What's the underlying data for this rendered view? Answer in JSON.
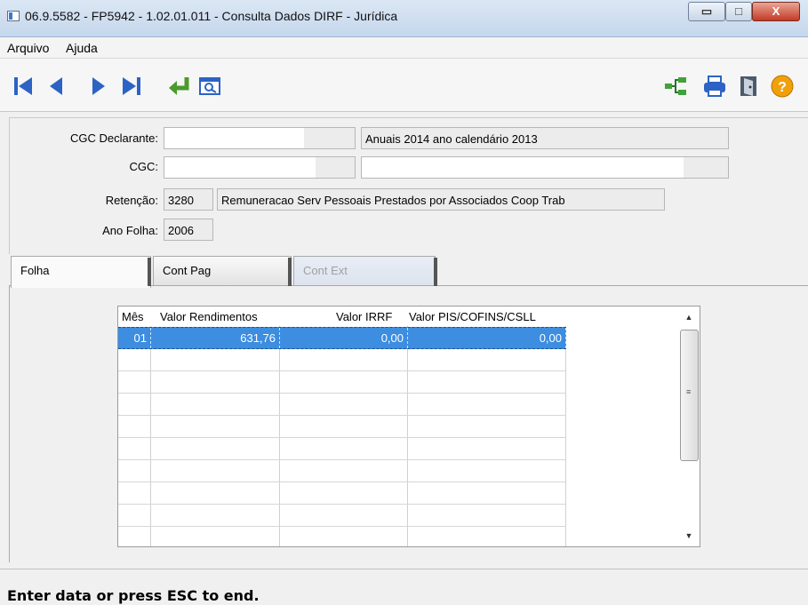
{
  "window": {
    "title": "06.9.5582 - FP5942 - 1.02.01.011 - Consulta Dados DIRF - Jurídica",
    "controls": {
      "minimize": "▭",
      "maximize": "□",
      "close": "X"
    }
  },
  "menu": [
    {
      "label": "Arquivo"
    },
    {
      "label": "Ajuda"
    }
  ],
  "toolbar": {
    "icons": [
      "first-record-icon",
      "previous-record-icon",
      "next-record-icon",
      "last-record-icon",
      "return-icon",
      "search-window-icon",
      "tree-structure-icon",
      "print-icon",
      "exit-door-icon",
      "help-icon"
    ],
    "accent": "#2c63c4"
  },
  "form": {
    "cgc_declarante": {
      "label": "CGC Declarante:",
      "value": "",
      "description": "Anuais 2014 ano calendário 2013"
    },
    "cgc": {
      "label": "CGC:",
      "value": "",
      "description": ""
    },
    "retencao": {
      "label": "Retenção:",
      "code": "3280",
      "description": "Remuneracao Serv Pessoais Prestados por Associados Coop Trab"
    },
    "ano_folha": {
      "label": "Ano Folha:",
      "value": "2006"
    }
  },
  "tabs": [
    {
      "label": "Folha",
      "state": "active"
    },
    {
      "label": "Cont Pag",
      "state": "normal"
    },
    {
      "label": "Cont Ext",
      "state": "disabled"
    }
  ],
  "grid": {
    "columns": [
      "Mês",
      "Valor Rendimentos",
      "Valor IRRF",
      "Valor PIS/COFINS/CSLL"
    ],
    "rows": [
      {
        "mes": "01",
        "rendimentos": "631,76",
        "irrf": "0,00",
        "pis": "0,00",
        "selected": true
      }
    ],
    "selection_color": "#3d8de0",
    "scrollbar": {
      "up": "▲",
      "down": "▼",
      "grip": "≡"
    }
  },
  "status": {
    "message": "Enter data or press ESC to end."
  }
}
